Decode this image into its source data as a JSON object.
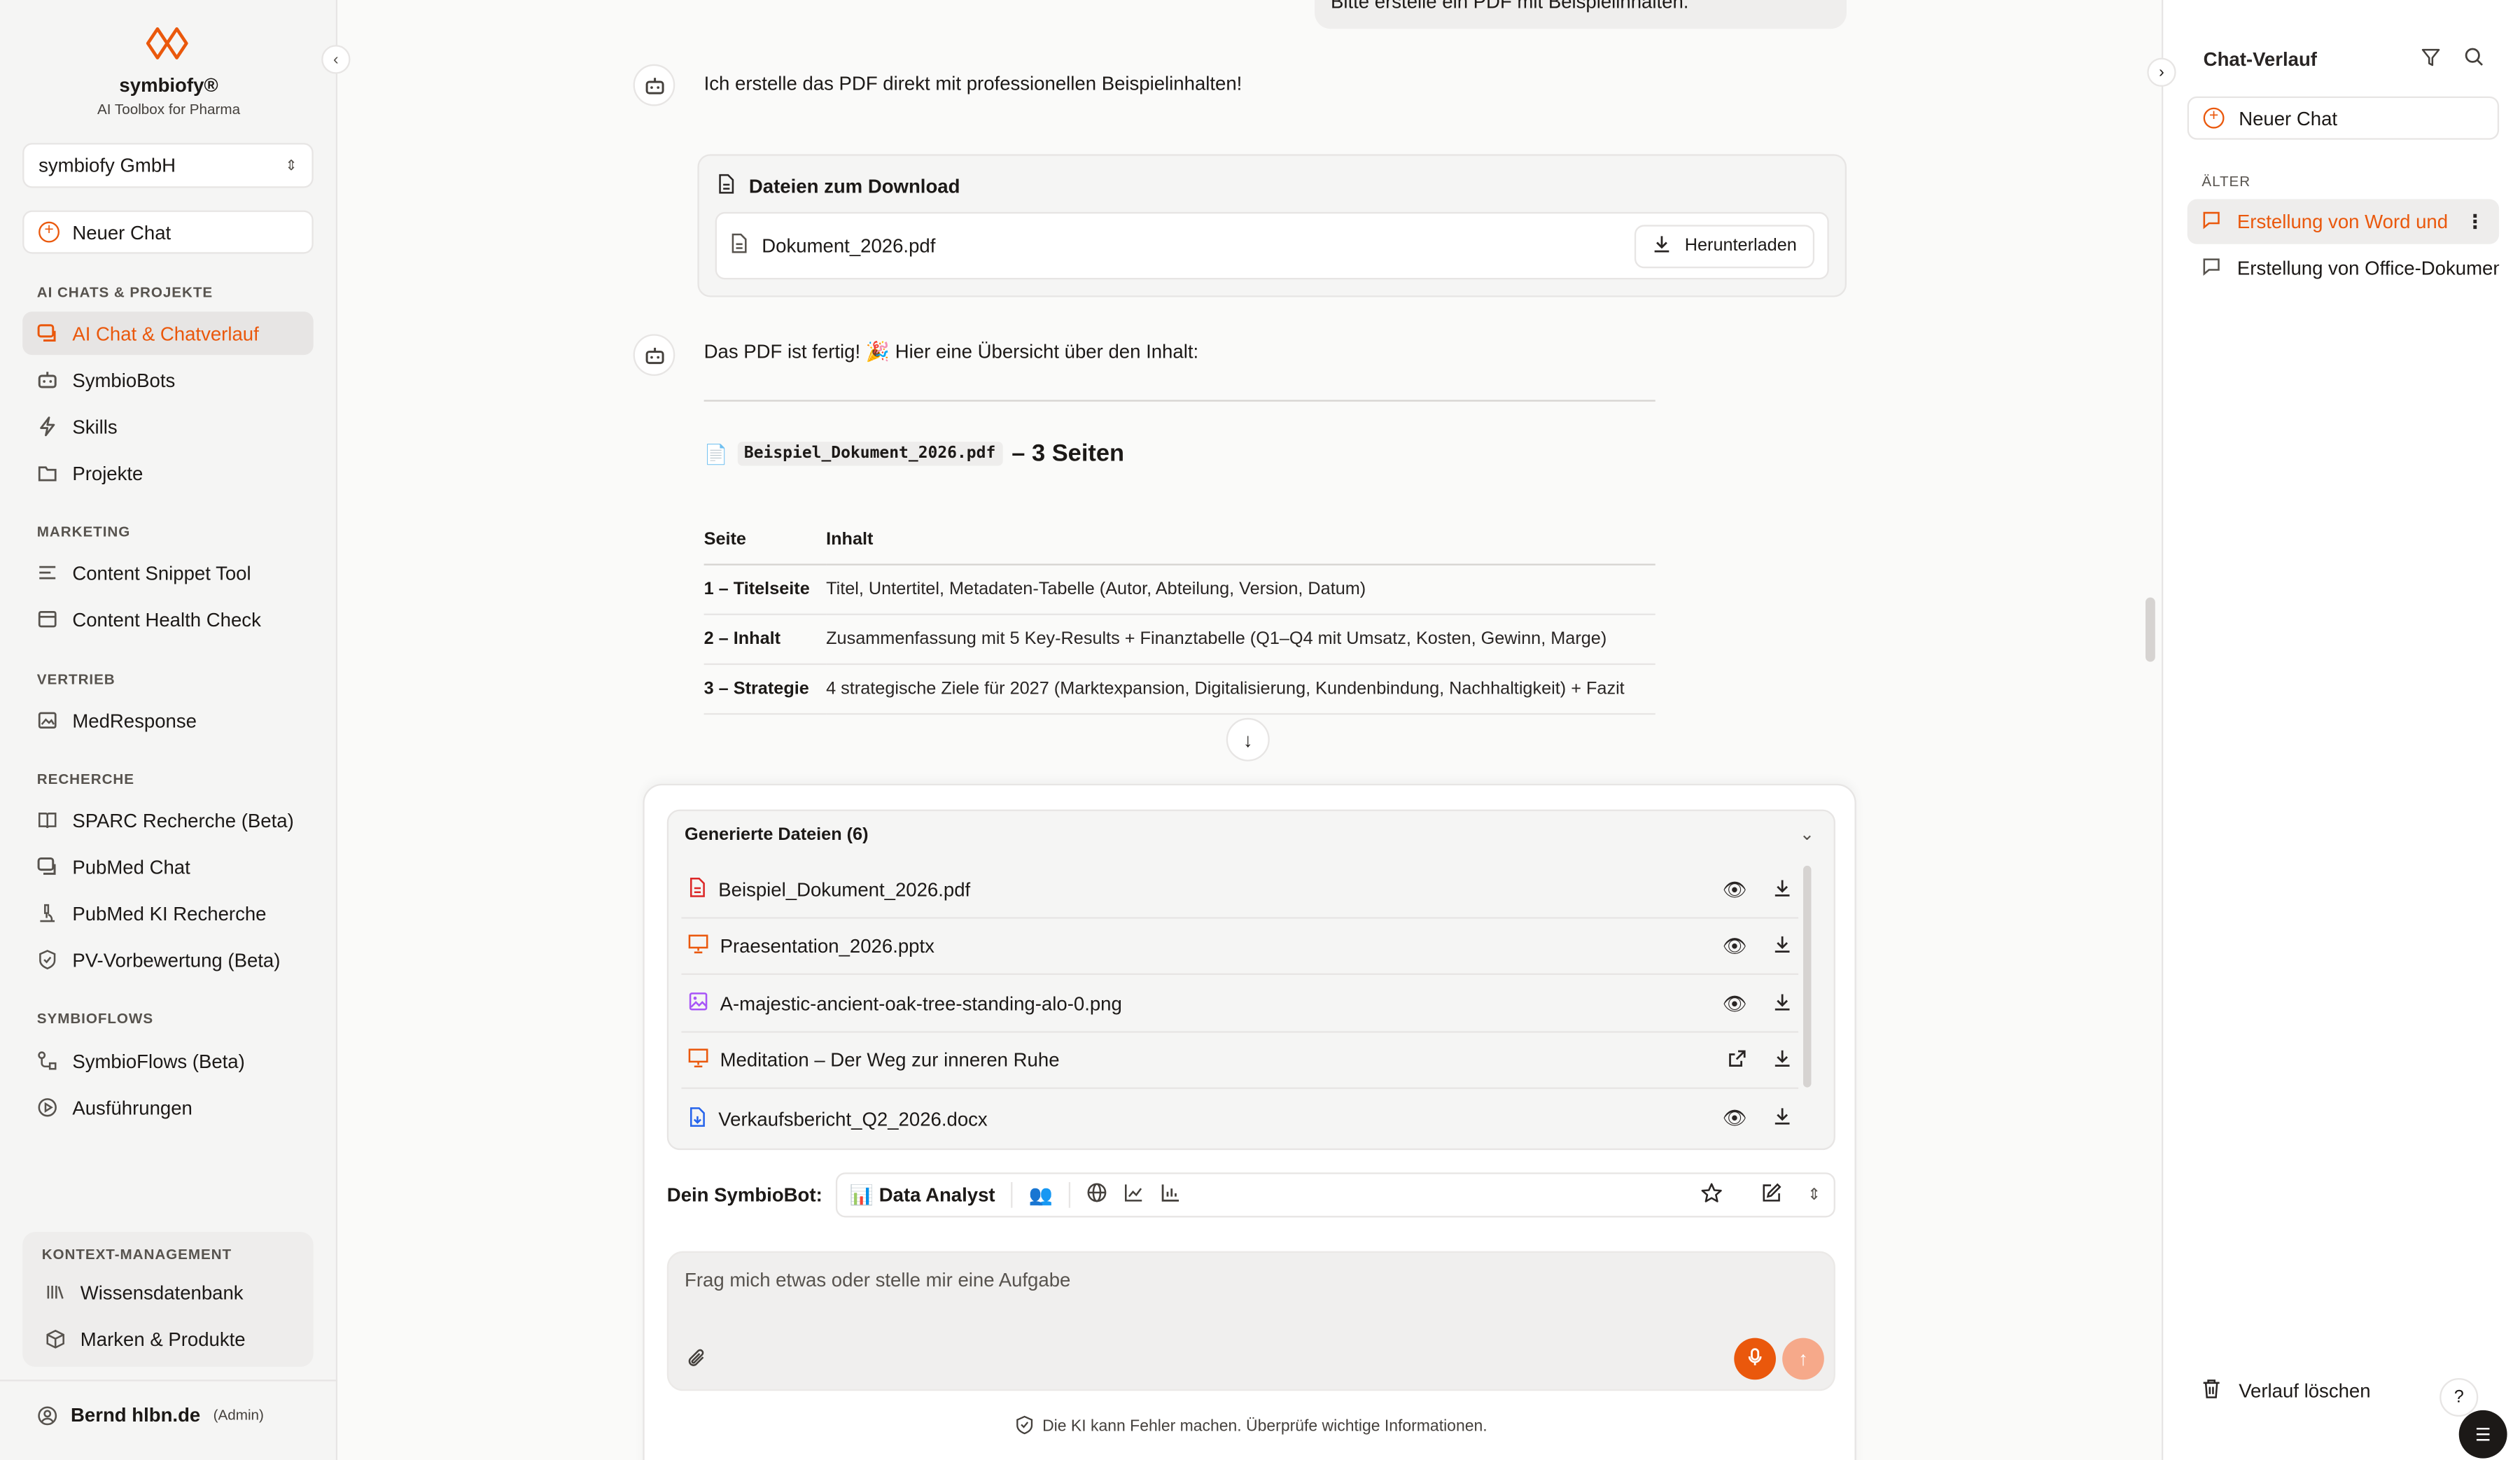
{
  "brand": {
    "name": "symbiofy®",
    "tagline": "AI Toolbox for Pharma",
    "accent": "#ea580c"
  },
  "org_selector": {
    "value": "symbiofy GmbH"
  },
  "sidebar": {
    "new_chat": "Neuer Chat",
    "sections": [
      {
        "title": "AI CHATS & PROJEKTE",
        "items": [
          {
            "label": "AI Chat & Chatverlauf",
            "icon": "chat-icon",
            "active": true
          },
          {
            "label": "SymbioBots",
            "icon": "bot-icon"
          },
          {
            "label": "Skills",
            "icon": "bolt-icon"
          },
          {
            "label": "Projekte",
            "icon": "folder-icon"
          }
        ]
      },
      {
        "title": "MARKETING",
        "items": [
          {
            "label": "Content Snippet Tool",
            "icon": "text-lines-icon"
          },
          {
            "label": "Content Health Check",
            "icon": "box-icon"
          }
        ]
      },
      {
        "title": "VERTRIEB",
        "items": [
          {
            "label": "MedResponse",
            "icon": "image-icon"
          }
        ]
      },
      {
        "title": "RECHERCHE",
        "items": [
          {
            "label": "SPARC Recherche (Beta)",
            "icon": "book-icon"
          },
          {
            "label": "PubMed Chat",
            "icon": "chat-icon"
          },
          {
            "label": "PubMed KI Recherche",
            "icon": "microscope-icon"
          },
          {
            "label": "PV-Vorbewertung (Beta)",
            "icon": "shield-icon"
          }
        ]
      },
      {
        "title": "SYMBIOFLOWS",
        "items": [
          {
            "label": "SymbioFlows (Beta)",
            "icon": "flow-icon"
          },
          {
            "label": "Ausführungen",
            "icon": "play-icon"
          }
        ]
      }
    ],
    "context": {
      "title": "KONTEXT-MANAGEMENT",
      "items": [
        {
          "label": "Wissensdatenbank",
          "icon": "library-icon"
        },
        {
          "label": "Marken & Produkte",
          "icon": "package-icon"
        }
      ]
    },
    "user": {
      "name": "Bernd hlbn.de",
      "role": "(Admin)"
    }
  },
  "chat": {
    "user_message": "Bitte erstelle ein PDF mit Beispielinhalten.",
    "bot_message_1": "Ich erstelle das PDF direkt mit professionellen Beispielinhalten!",
    "downloads": {
      "title": "Dateien zum Download",
      "file": "Dokument_2026.pdf",
      "button": "Herunterladen"
    },
    "bot_message_2": "Das PDF ist fertig! 🎉 Hier eine Übersicht über den Inhalt:",
    "doc_title_code": "Beispiel_Dokument_2026.pdf",
    "doc_title_rest": "– 3 Seiten",
    "table": {
      "headers": [
        "Seite",
        "Inhalt"
      ],
      "rows": [
        [
          "1 – Titelseite",
          "Titel, Untertitel, Metadaten-Tabelle (Autor, Abteilung, Version, Datum)"
        ],
        [
          "2 – Inhalt",
          "Zusammenfassung mit 5 Key-Results + Finanztabelle (Q1–Q4 mit Umsatz, Kosten, Gewinn, Marge)"
        ],
        [
          "3 – Strategie",
          "4 strategische Ziele für 2027 (Marktexpansion, Digitalisierung, Kundenbindung, Nachhaltigkeit) + Fazit"
        ]
      ]
    }
  },
  "generated_files": {
    "title": "Generierte Dateien (6)",
    "files": [
      {
        "name": "Beispiel_Dokument_2026.pdf",
        "icon": "pdf-file-icon",
        "color": "#dc2626",
        "action": "eye-icon"
      },
      {
        "name": "Praesentation_2026.pptx",
        "icon": "presentation-icon",
        "color": "#ea580c",
        "action": "eye-icon"
      },
      {
        "name": "A-majestic-ancient-oak-tree-standing-alo-0.png",
        "icon": "image-file-icon",
        "color": "#a855f7",
        "action": "eye-icon"
      },
      {
        "name": "Meditation – Der Weg zur inneren Ruhe",
        "icon": "presentation-icon",
        "color": "#ea580c",
        "action": "external-link-icon"
      },
      {
        "name": "Verkaufsbericht_Q2_2026.docx",
        "icon": "doc-file-icon",
        "color": "#2563eb",
        "action": "eye-icon"
      }
    ]
  },
  "composer": {
    "bot_label": "Dein SymbioBot:",
    "bot_name": "📊 Data Analyst",
    "placeholder": "Frag mich etwas oder stelle mir eine Aufgabe",
    "disclaimer": "Die KI kann Fehler machen. Überprüfe wichtige Informationen."
  },
  "history": {
    "title": "Chat-Verlauf",
    "new_chat": "Neuer Chat",
    "section": "ÄLTER",
    "items": [
      {
        "label": "Erstellung von Word und",
        "active": true
      },
      {
        "label": "Erstellung von Office-Dokumenten"
      }
    ],
    "delete": "Verlauf löschen"
  }
}
